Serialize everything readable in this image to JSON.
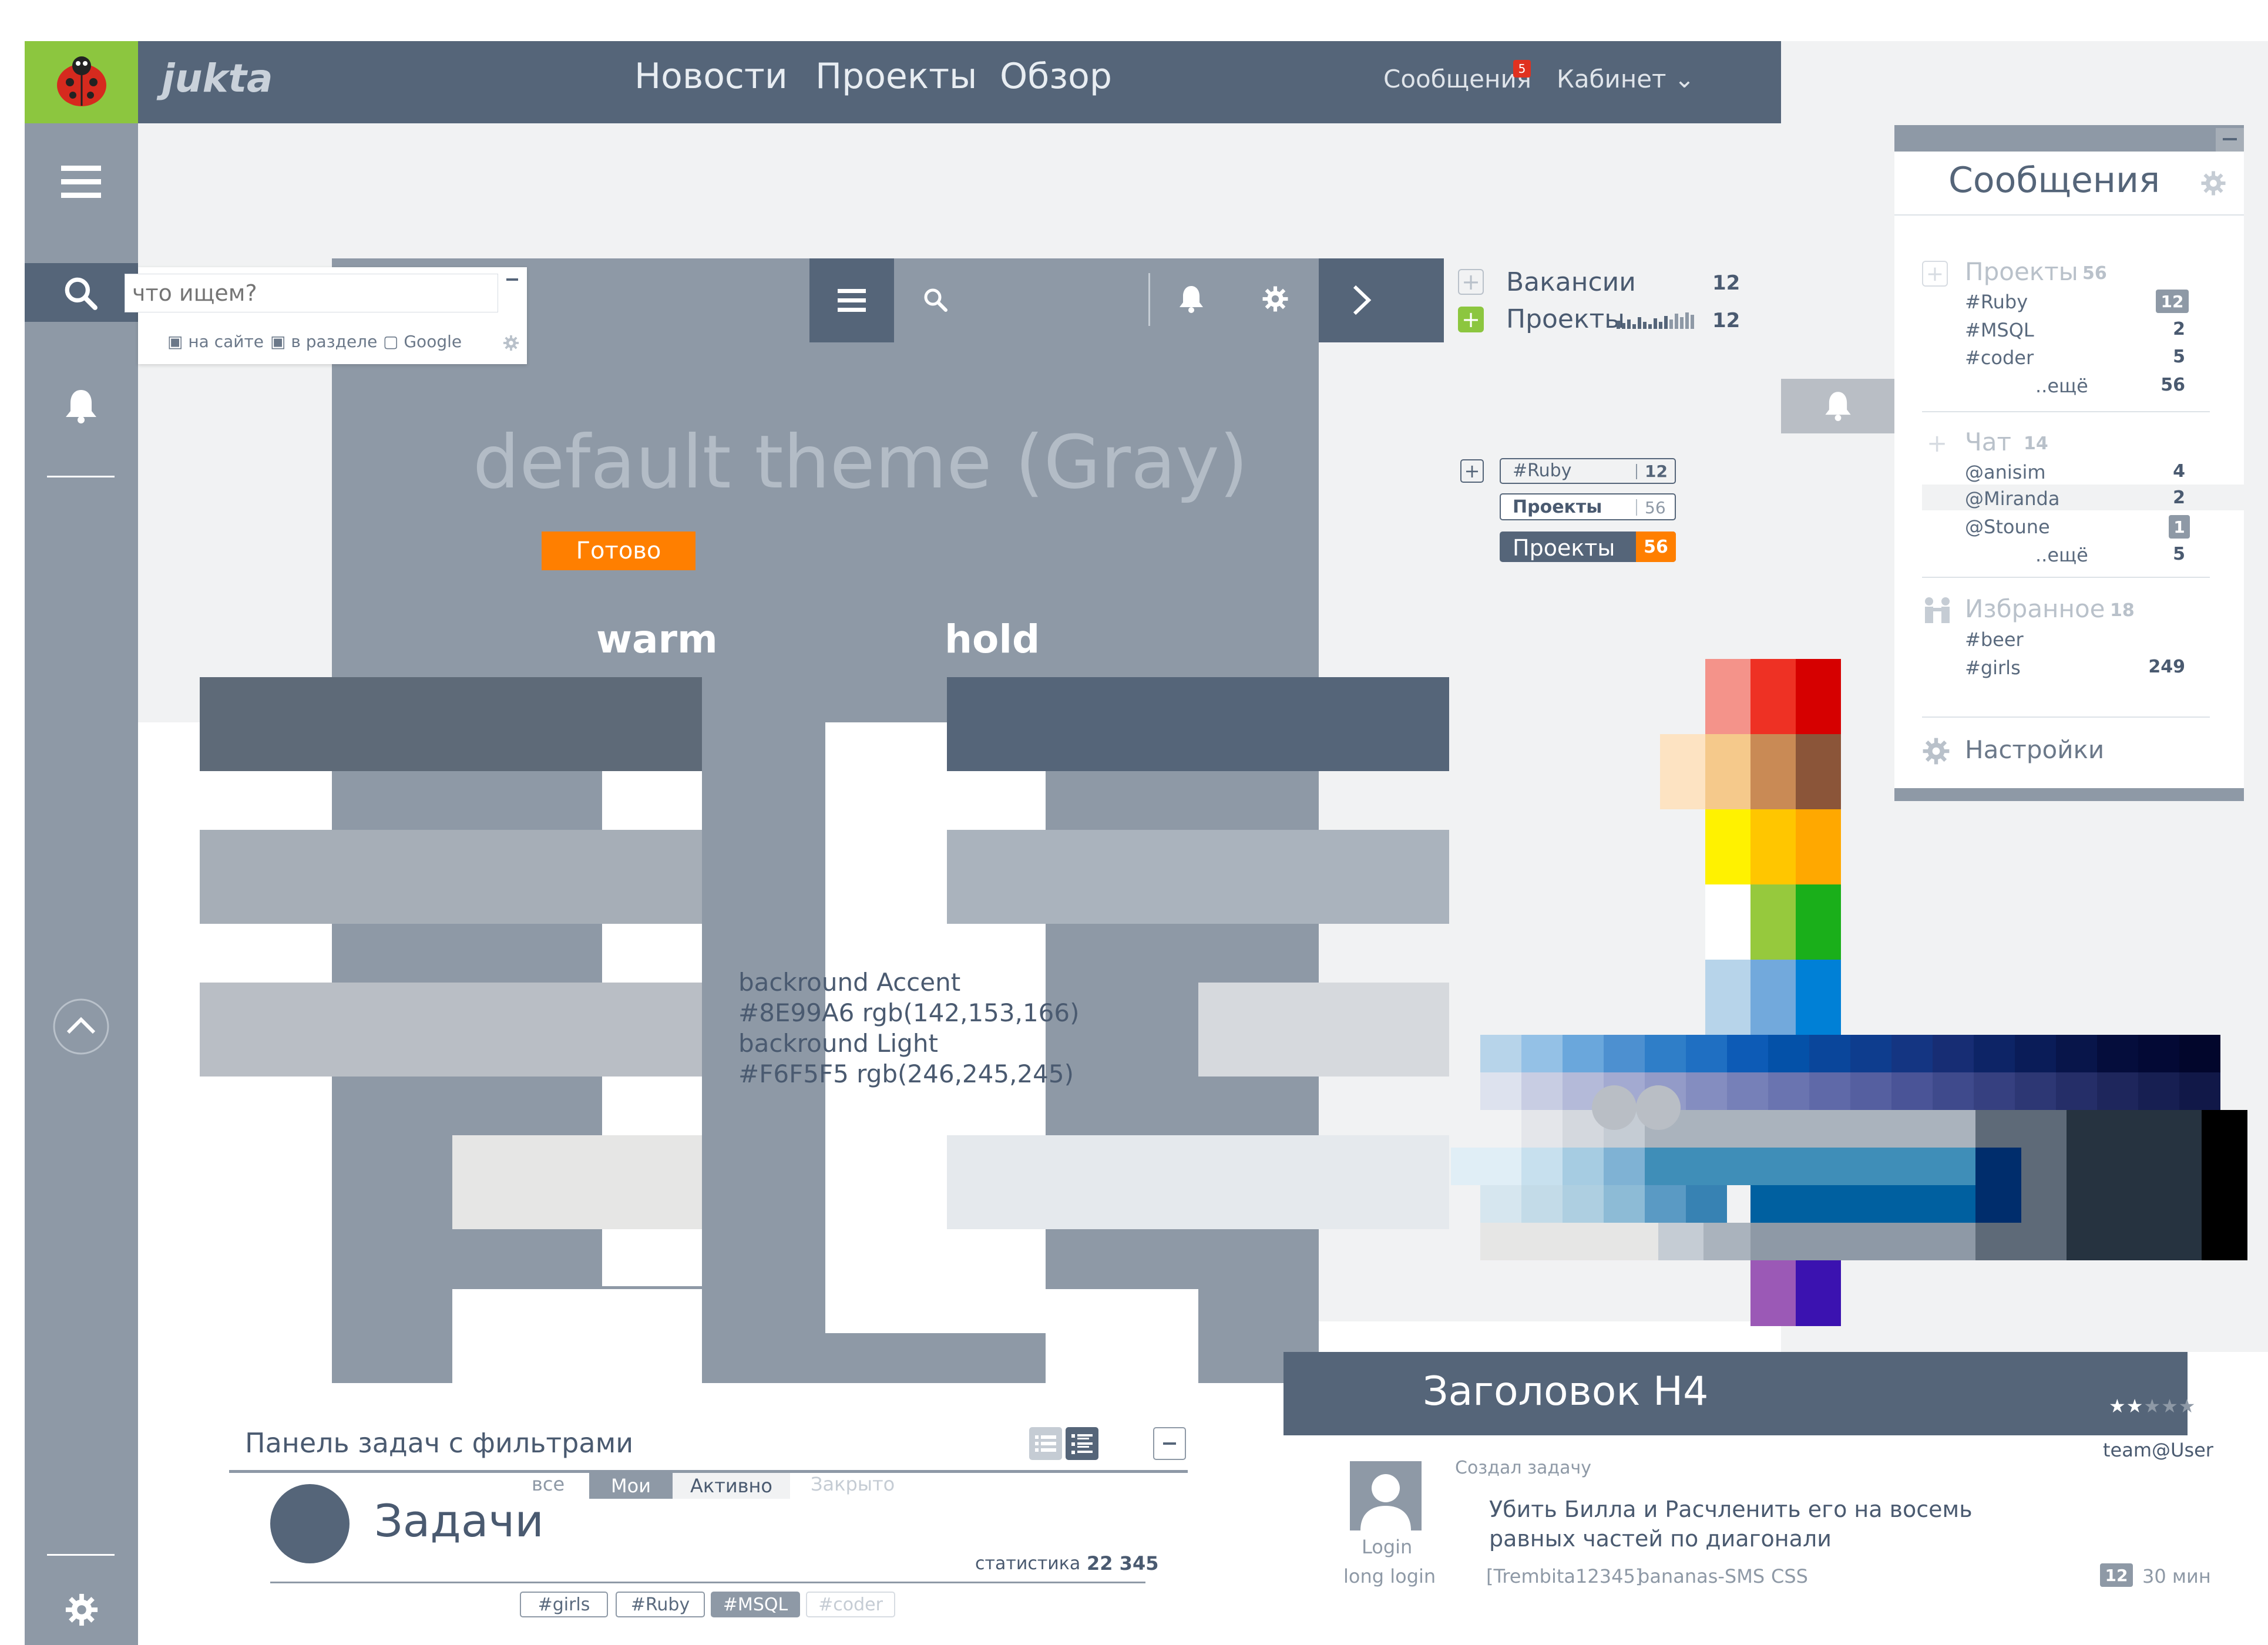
{
  "app": {
    "logo_text": "jukta",
    "nav": [
      "Новости",
      "Проекты",
      "Обзор"
    ],
    "messages_label": "Сообщения",
    "messages_badge": "5",
    "cabinet_label": "Кабинет ⌄"
  },
  "search": {
    "placeholder": "что ищем?",
    "scopes": [
      "на сайте",
      "в разделе",
      "Google"
    ]
  },
  "theme": {
    "title": "default theme (Gray)",
    "done_button": "Готово",
    "warm_label": "warm",
    "hold_label": "hold",
    "accent_lines": [
      "backround Accent",
      "#8E99A6 rgb(142,153,166)",
      "backround Light",
      "#F6F5F5 rgb(246,245,245)"
    ],
    "colors": {
      "accent": "#8E99A6",
      "light": "#F6F5F5",
      "dark_warm": "#5E6A78",
      "dark_hold": "#556579",
      "orange": "#FF7F00"
    }
  },
  "counters": {
    "vacancies_label": "Вакансии",
    "vacancies_count": "12",
    "projects_label": "Проекты",
    "projects_count": "12",
    "tag_ruby": "#Ruby",
    "tag_ruby_count": "12",
    "tag_projects": "Проекты",
    "tag_projects_count": "56",
    "projects_pill": "Проекты",
    "projects_pill_count": "56"
  },
  "messages_panel": {
    "title": "Сообщения",
    "projects_header": "Проекты",
    "projects_total": "56",
    "projects_items": [
      {
        "label": "#Ruby",
        "count": "12"
      },
      {
        "label": "#MSQL",
        "count": "2"
      },
      {
        "label": "#coder",
        "count": "5"
      },
      {
        "label": "..ещё",
        "count": "56"
      }
    ],
    "chat_header": "Чат",
    "chat_total": "14",
    "chat_items": [
      {
        "label": "@anisim",
        "count": "4"
      },
      {
        "label": "@Miranda",
        "count": "2"
      },
      {
        "label": "@Stoune",
        "count": "1"
      },
      {
        "label": "..ещё",
        "count": "5"
      }
    ],
    "fav_header": "Избранное",
    "fav_total": "18",
    "fav_items": [
      {
        "label": "#beer",
        "count": ""
      },
      {
        "label": "#girls",
        "count": "249"
      }
    ],
    "settings_label": "Настройки"
  },
  "task_panel": {
    "title": "Панель задач с фильтрами",
    "filters": [
      "все",
      "Мои",
      "Активно",
      "Закрыто"
    ],
    "heading": "Задачи",
    "stats_label": "статистика",
    "stats_value": "22 345",
    "tags": [
      "#girls",
      "#Ruby",
      "#MSQL",
      "#coder"
    ]
  },
  "card": {
    "title": "Заголовок H4",
    "author": "team@User",
    "action": "Создал задачу",
    "body": [
      "Убить Билла и Расчленить его на восемь",
      "равных частей по диагонали"
    ],
    "login": "Login",
    "long_login": "long login",
    "tags": [
      "[Trembita12345]",
      "bananas-SMS",
      "CSS"
    ],
    "comments": "12",
    "time": "30 мин"
  }
}
